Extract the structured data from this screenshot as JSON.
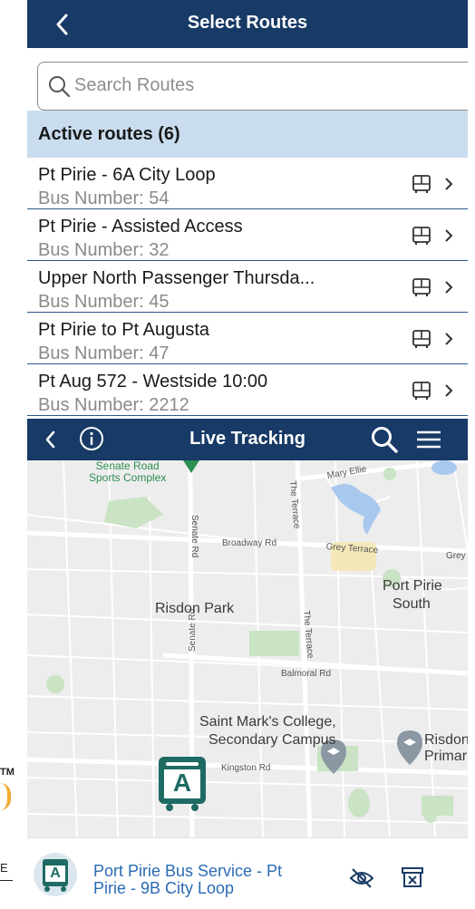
{
  "header": {
    "title": "Select Routes"
  },
  "search": {
    "placeholder": "Search Routes"
  },
  "active_routes": {
    "label": "Active routes (6)"
  },
  "routes": [
    {
      "name": "Pt Pirie - 6A City Loop",
      "bus": "Bus Number: 54"
    },
    {
      "name": "Pt Pirie - Assisted Access",
      "bus": "Bus Number: 32"
    },
    {
      "name": "Upper North Passenger Thursda...",
      "bus": "Bus Number: 45"
    },
    {
      "name": "Pt Pirie to Pt Augusta",
      "bus": "Bus Number: 47"
    },
    {
      "name": "Pt Aug 572 - Westside 10:00",
      "bus": "Bus Number: 2212"
    }
  ],
  "tracking": {
    "title": "Live Tracking"
  },
  "map": {
    "labels": {
      "sports": "Senate Road\nSports Complex",
      "mary": "Mary Ellie",
      "terrace1": "The Terrace",
      "senate1": "Senate Rd",
      "broadway": "Broadway Rd",
      "grey": "Grey Terrace",
      "grey2": "Grey",
      "portpirie": "Port Pirie",
      "south": "South",
      "risdon": "Risdon Park",
      "terrace2": "The Terrace",
      "senate2": "Senate Rd",
      "balmoral": "Balmoral Rd",
      "college1": "Saint Mark's College,",
      "college2": "Secondary Campus",
      "kingston": "Kingston Rd",
      "risdon2": "Risdon",
      "primary": "Primar"
    },
    "bus_marker": "A"
  },
  "selected_bus": {
    "name": "Port Pirie Bus Service - Pt Pirie - 9B City Loop",
    "letter": "A"
  },
  "colors": {
    "header": "#173a66",
    "accent": "#2b6bb3",
    "active_bg": "#c9ddef",
    "bus_marker": "#1e6b63"
  },
  "outside": {
    "tm": "TM",
    "e": "E"
  }
}
